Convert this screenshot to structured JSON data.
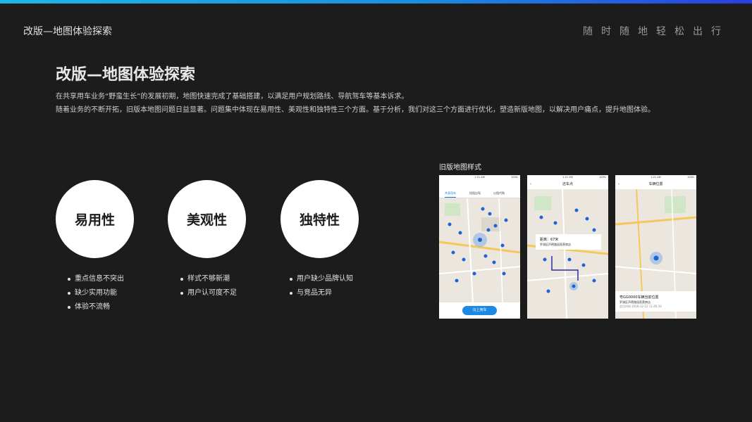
{
  "header": {
    "left_title": "改版—地图体验探索",
    "right_slogan": "随时随地轻松出行"
  },
  "main": {
    "title": "改版—地图体验探索",
    "desc_line1": "在共享用车业务“野蛮生长”的发展初期，地图快速完成了基础搭建，以满足用户规划路线、导航驾车等基本诉求。",
    "desc_line2": "随着业务的不断开拓，旧版本地图问题日益显著。问题集中体现在易用性、美观性和独特性三个方面。基于分析，我们对这三个方面进行优化，塑造新版地图，以解决用户痛点，提升地图体验。"
  },
  "aspects": [
    {
      "label": "易用性",
      "bullets": [
        "重点信息不突出",
        "缺少实用功能",
        "体验不流畅"
      ]
    },
    {
      "label": "美观性",
      "bullets": [
        "样式不够新潮",
        "用户认可度不足"
      ]
    },
    {
      "label": "独特性",
      "bullets": [
        "用户缺少品牌认知",
        "与竞品无异"
      ]
    }
  ],
  "old_maps": {
    "label": "旧版地图样式",
    "status_time": "1:21 AM",
    "status_battery": "100%",
    "phone1": {
      "tabs": [
        "共享用车",
        "短租自驾",
        "以租代购"
      ],
      "button": "马上用车"
    },
    "phone2": {
      "title": "还车点",
      "distance": "距离：67米",
      "address": "罗湖区声德路园直营商店"
    },
    "phone3": {
      "title": "车辆位置",
      "plate": "粤GG0000车辆当前位置",
      "address": "罗湖区声德路园直营商店",
      "time": "定位时间 2018-12-12 11:40:34"
    }
  }
}
